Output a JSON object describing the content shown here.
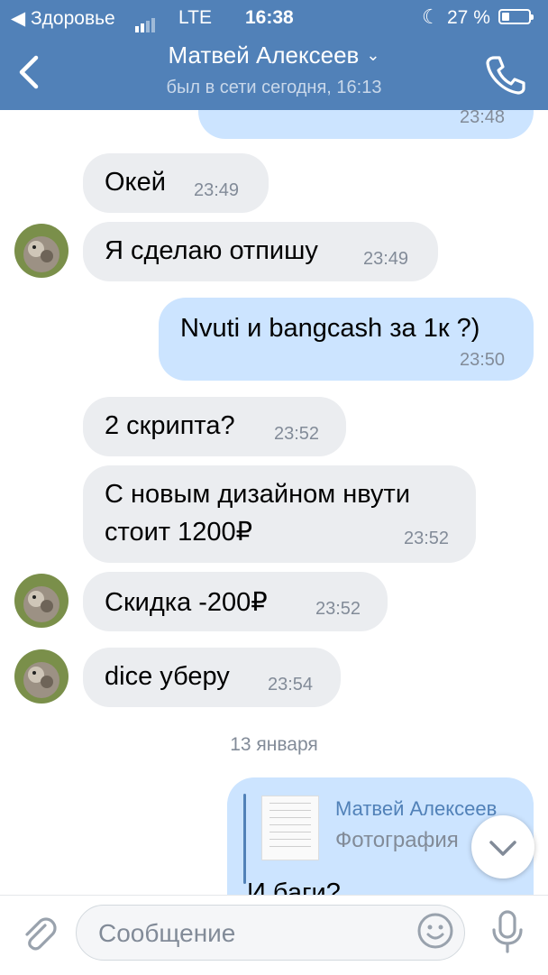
{
  "status_bar": {
    "back_app": "◀ Здоровье",
    "carrier": "LTE",
    "time": "16:38",
    "battery_pct": "27 %"
  },
  "header": {
    "title": "Матвей Алексеев",
    "subtitle": "был в сети сегодня, 16:13"
  },
  "messages": {
    "m0": {
      "time": "23:48"
    },
    "m1": {
      "text": "Окей",
      "time": "23:49"
    },
    "m2": {
      "text": "Я сделаю отпишу",
      "time": "23:49"
    },
    "m3": {
      "text": "Nvuti и bangcash за 1к ?)",
      "time": "23:50"
    },
    "m4": {
      "text": "2 скрипта?",
      "time": "23:52"
    },
    "m5": {
      "line1": "С новым дизайном нвути",
      "line2": "стоит 1200₽",
      "time": "23:52"
    },
    "m6": {
      "text": "Скидка -200₽",
      "time": "23:52"
    },
    "m7": {
      "text": "dice уберу",
      "time": "23:54"
    }
  },
  "date_separator": "13 января",
  "reply": {
    "name": "Матвей Алексеев",
    "kind": "Фотография",
    "text": "И баги?"
  },
  "composer": {
    "placeholder": "Сообщение"
  },
  "colors": {
    "header_bg": "#5181b8",
    "incoming_bubble": "#ebedf0",
    "outgoing_bubble": "#cce4ff",
    "time_text": "#828b98"
  },
  "icons": [
    "back-arrow-icon",
    "phone-icon",
    "chevron-down-icon",
    "paperclip-icon",
    "smile-icon",
    "microphone-icon",
    "moon-icon",
    "battery-icon"
  ]
}
